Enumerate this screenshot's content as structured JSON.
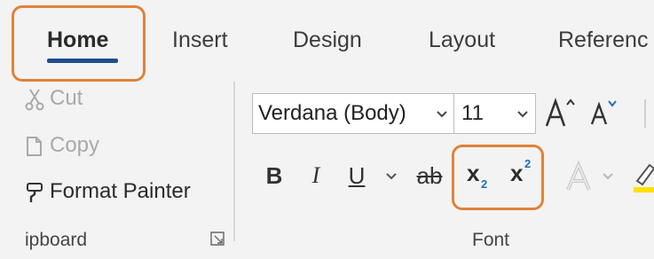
{
  "tabs": [
    {
      "label": "Home",
      "active": true
    },
    {
      "label": "Insert"
    },
    {
      "label": "Design"
    },
    {
      "label": "Layout"
    },
    {
      "label": "Referenc"
    }
  ],
  "clipboard": {
    "cut_label": "Cut",
    "copy_label": "Copy",
    "format_painter_label": "Format Painter",
    "group_label": "ipboard"
  },
  "font": {
    "font_name": "Verdana (Body)",
    "font_size": "11",
    "bold": "B",
    "italic": "I",
    "underline": "U",
    "strikethrough": "ab",
    "subscript_base": "x",
    "subscript_mark": "2",
    "superscript_base": "x",
    "superscript_mark": "2",
    "group_label": "Font"
  },
  "colors": {
    "accent": "#1f4e8c",
    "highlight_outline": "#e0823a",
    "ribbon_bg": "#f3f3f3",
    "text_highlight_yellow": "#ffe100"
  },
  "icons": [
    "cut-icon",
    "copy-icon",
    "format-painter-icon",
    "dialog-launcher-icon",
    "grow-font-icon",
    "shrink-font-icon",
    "text-effects-icon",
    "text-highlight-icon",
    "chevron-down-icon"
  ]
}
